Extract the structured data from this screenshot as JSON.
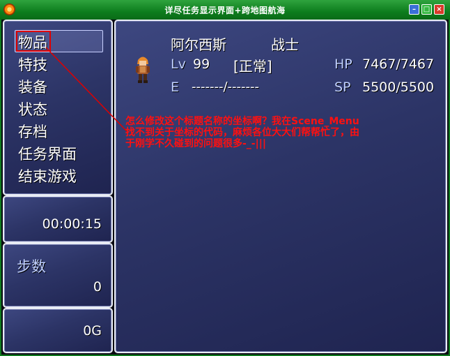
{
  "window": {
    "title": "详尽任务显示界面+跨地图航海",
    "buttons": {
      "minimize": "–",
      "maximize": "□",
      "close": "×"
    }
  },
  "menu": {
    "items": [
      "物品",
      "特技",
      "装备",
      "状态",
      "存档",
      "任务界面",
      "结束游戏"
    ],
    "selected_index": 0
  },
  "playtime": {
    "value": "00:00:15"
  },
  "steps": {
    "label": "步数",
    "value": "0"
  },
  "gold": {
    "value": "0G"
  },
  "actor": {
    "name": "阿尔西斯",
    "class": "战士",
    "level_label": "Lv",
    "level": "99",
    "state": "[正常]",
    "exp_label": "E",
    "exp": "-------/-------",
    "hp_label": "HP",
    "hp": "7467/7467",
    "sp_label": "SP",
    "sp": "5500/5500"
  },
  "annotation": {
    "text": "怎么修改这个标题名称的坐标啊？我在Scene_Menu找不到关于坐标的代码，麻烦各位大大们帮帮忙了，由于刚学不久碰到的问题很多-_-|||",
    "color": "#ff1010"
  },
  "colors": {
    "title_bar": "#0d7d1d",
    "window_bg": "#2c3466",
    "system_text": "#c0d0ff",
    "annotation_red": "#e00000"
  }
}
